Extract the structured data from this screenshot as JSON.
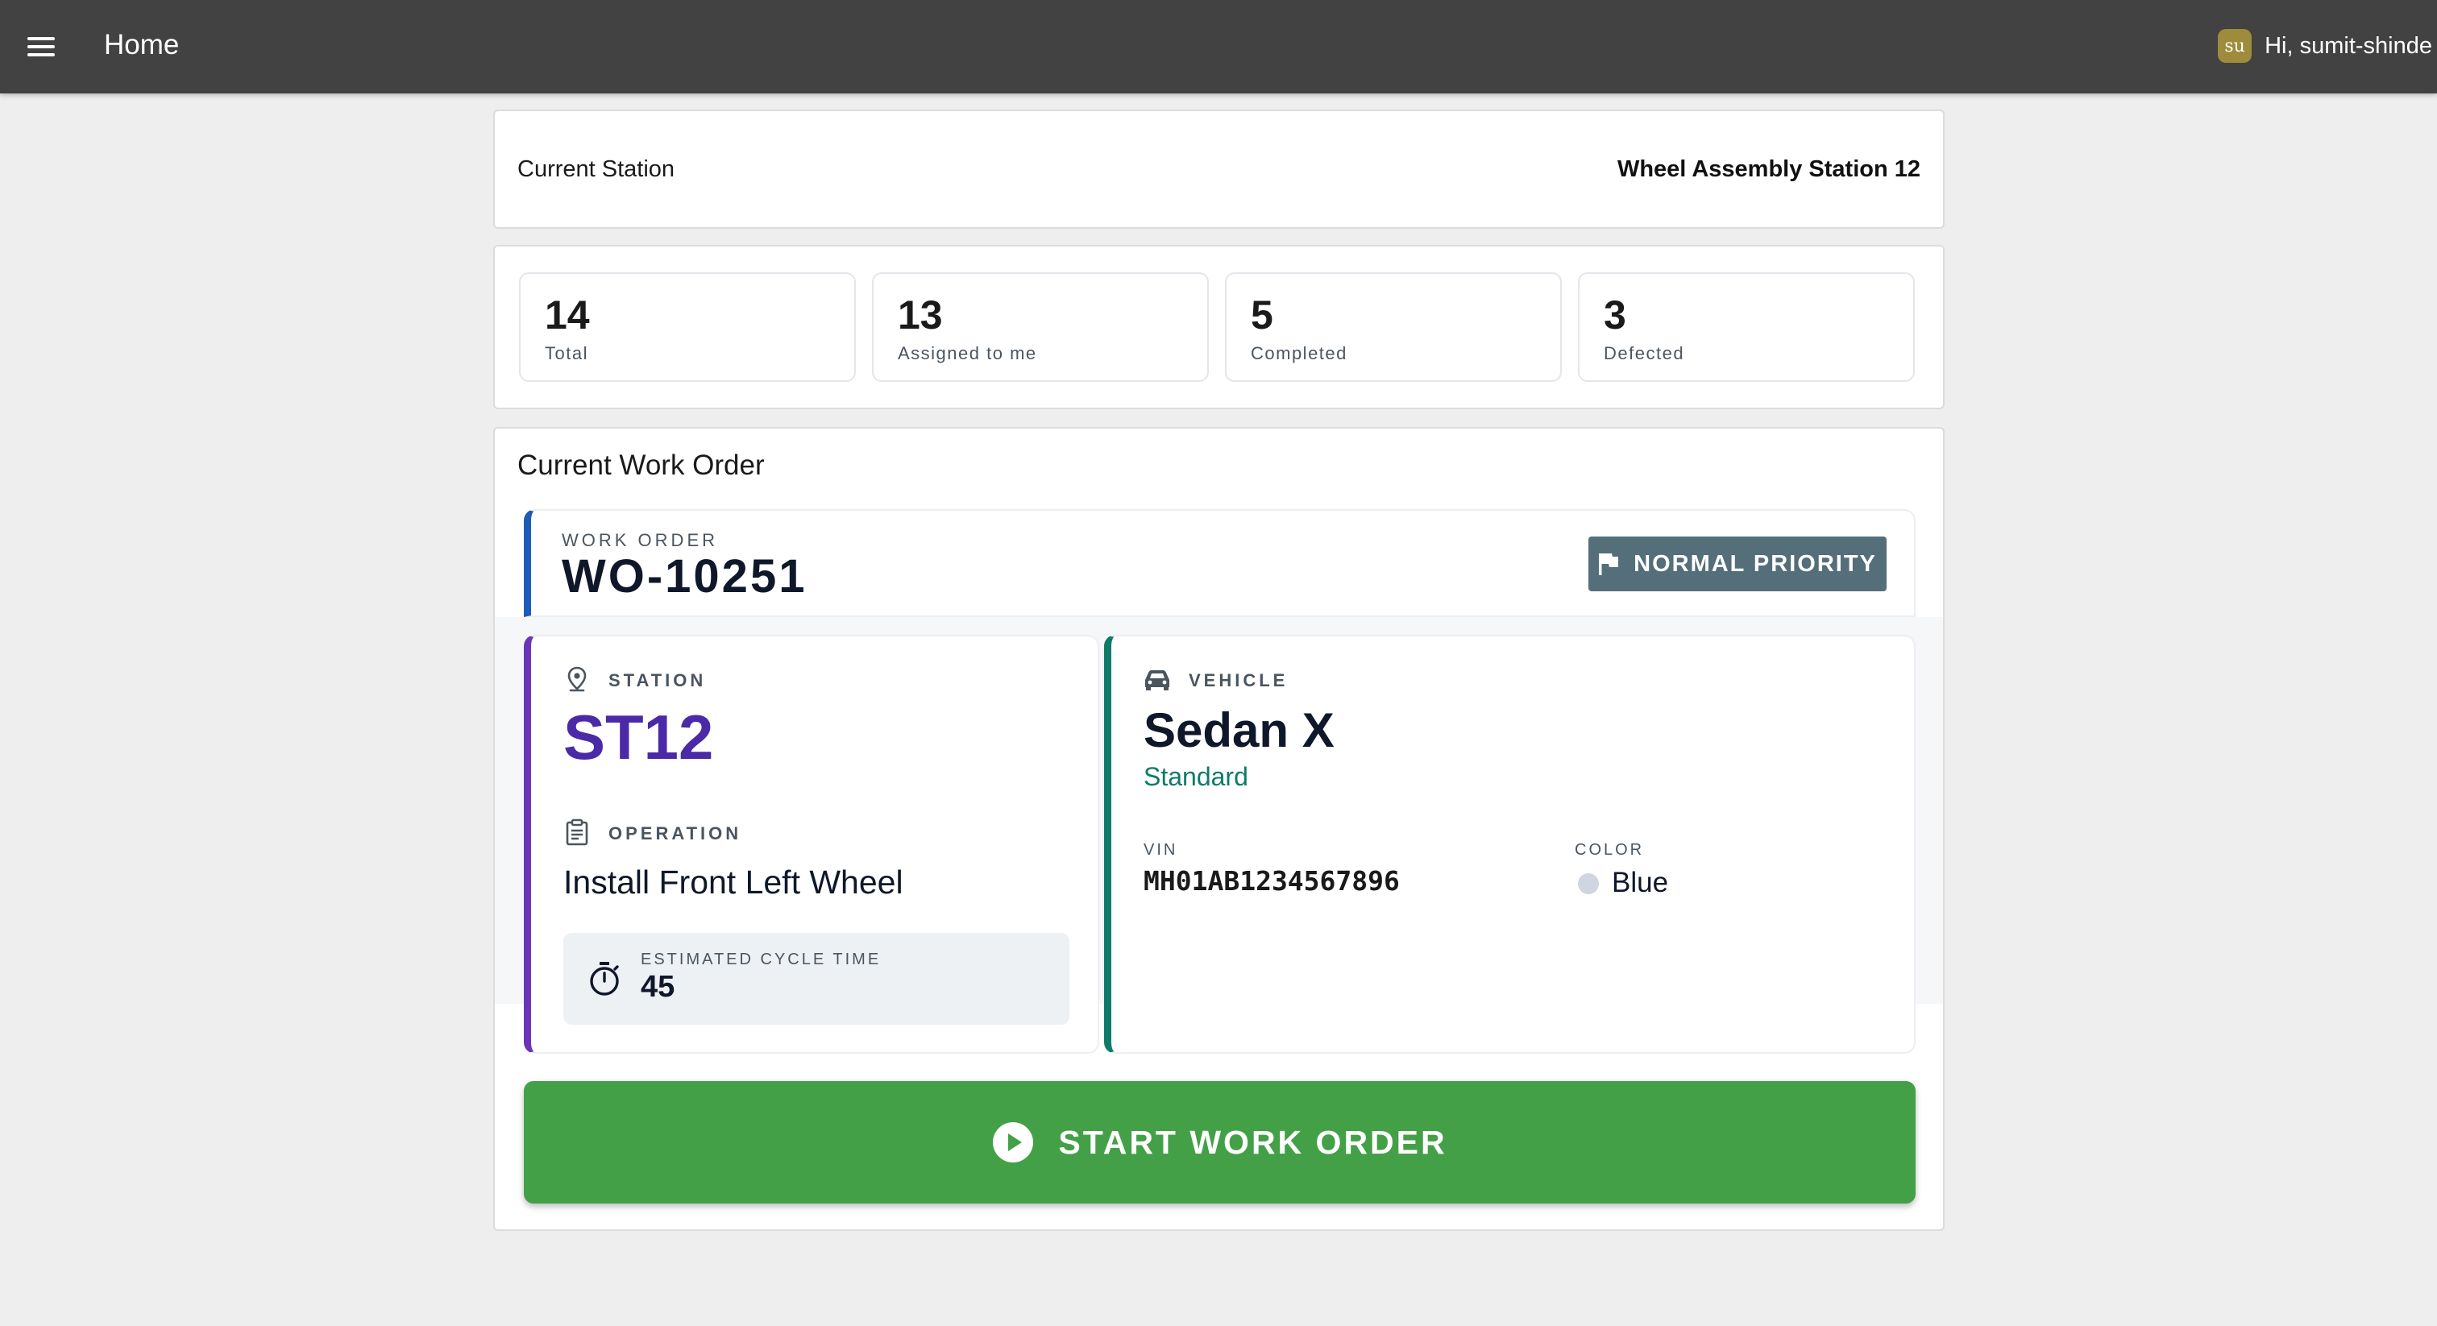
{
  "appbar": {
    "title": "Home",
    "user_initials": "su",
    "user_greeting": "Hi, sumit-shinde"
  },
  "station": {
    "label": "Current Station",
    "value": "Wheel Assembly Station 12"
  },
  "stats": [
    {
      "value": "14",
      "label": "Total"
    },
    {
      "value": "13",
      "label": "Assigned to me"
    },
    {
      "value": "5",
      "label": "Completed"
    },
    {
      "value": "3",
      "label": "Defected"
    }
  ],
  "work_order": {
    "heading": "Current Work Order",
    "sub_label": "WORK ORDER",
    "number": "WO-10251",
    "priority": "NORMAL PRIORITY",
    "station_label": "STATION",
    "station_code": "ST12",
    "operation_label": "OPERATION",
    "operation": "Install Front Left Wheel",
    "cycle_label": "ESTIMATED CYCLE TIME",
    "cycle_value": "45",
    "vehicle_label": "VEHICLE",
    "vehicle_model": "Sedan X",
    "vehicle_variant": "Standard",
    "vin_label": "VIN",
    "vin": "MH01AB1234567896",
    "color_label": "COLOR",
    "color": "Blue",
    "start_label": "START WORK ORDER"
  },
  "colors": {
    "appbar": "#424242",
    "work_order_accent": "#1e5bb8",
    "station_accent": "#6a35b8",
    "vehicle_accent": "#0f7a68",
    "priority_bg": "#546e7a",
    "start_button": "#43a047"
  },
  "icons": {
    "menu": "menu-icon",
    "priority": "flag-icon",
    "station": "location-pin-icon",
    "operation": "clipboard-icon",
    "cycle": "stopwatch-icon",
    "vehicle": "car-icon",
    "start": "play-circle-icon"
  }
}
